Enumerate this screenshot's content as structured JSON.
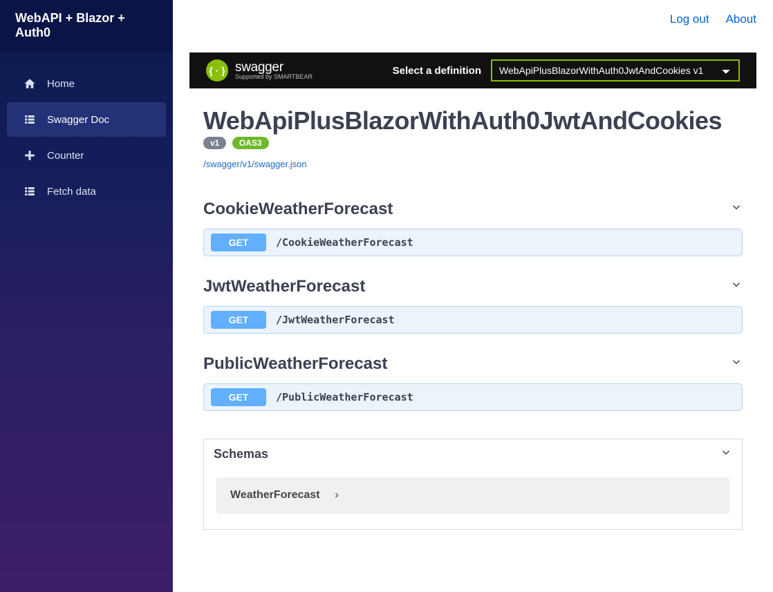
{
  "brand": "WebAPI + Blazor + Auth0",
  "nav": [
    {
      "label": "Home",
      "icon": "home",
      "active": false
    },
    {
      "label": "Swagger Doc",
      "icon": "list",
      "active": true
    },
    {
      "label": "Counter",
      "icon": "plus",
      "active": false
    },
    {
      "label": "Fetch data",
      "icon": "list",
      "active": false
    }
  ],
  "topbar": {
    "logout": "Log out",
    "about": "About"
  },
  "swagger": {
    "logo_main": "swagger",
    "logo_sub": "Supported by SMARTBEAR",
    "definition_label": "Select a definition",
    "definition_selected": "WebApiPlusBlazorWithAuth0JwtAndCookies v1"
  },
  "api": {
    "title": "WebApiPlusBlazorWithAuth0JwtAndCookies",
    "version_badge": "v1",
    "oas_badge": "OAS3",
    "json_url": "/swagger/v1/swagger.json"
  },
  "tags": [
    {
      "name": "CookieWeatherForecast",
      "ops": [
        {
          "method": "GET",
          "path": "/CookieWeatherForecast"
        }
      ]
    },
    {
      "name": "JwtWeatherForecast",
      "ops": [
        {
          "method": "GET",
          "path": "/JwtWeatherForecast"
        }
      ]
    },
    {
      "name": "PublicWeatherForecast",
      "ops": [
        {
          "method": "GET",
          "path": "/PublicWeatherForecast"
        }
      ]
    }
  ],
  "schemas": {
    "label": "Schemas",
    "items": [
      {
        "name": "WeatherForecast"
      }
    ]
  }
}
